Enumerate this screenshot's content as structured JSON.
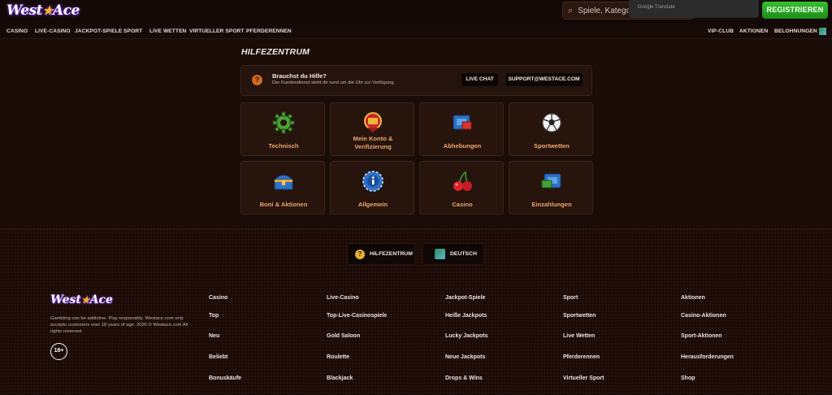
{
  "header": {
    "logo_text_a": "West",
    "logo_text_b": "Ace",
    "search_placeholder": "Spiele, Kategorie",
    "google_translate": "Google Translate",
    "register_label": "REGISTRIEREN"
  },
  "nav": {
    "left": [
      "CASINO",
      "LIVE-CASINO",
      "JACKPOT-SPIELE",
      "SPORT",
      "LIVE WETTEN",
      "VIRTUELLER SPORT",
      "PFERDERENNEN"
    ],
    "right": [
      "VIP-CLUB",
      "AKTIONEN",
      "BELOHNUNGEN"
    ]
  },
  "help": {
    "title": "HILFEZENTRUM",
    "banner_question": "Brauchst du Hilfe?",
    "banner_sub": "Der Kundendienst steht dir rund um die Uhr zur Verfügung.",
    "live_chat": "LIVE CHAT",
    "support_email": "SUPPORT@WESTACE.COM",
    "icon_mark": "?",
    "categories": [
      {
        "label_lines": [
          "Technisch"
        ],
        "icon": "gear-icon"
      },
      {
        "label_lines": [
          "Mein Konto &",
          "Verifizierung"
        ],
        "icon": "account-badge-icon"
      },
      {
        "label_lines": [
          "Abhebungen"
        ],
        "icon": "withdrawal-icon"
      },
      {
        "label_lines": [
          "Sportwetten"
        ],
        "icon": "soccer-ball-icon"
      },
      {
        "label_lines": [
          "Boni & Aktionen"
        ],
        "icon": "treasure-chest-icon"
      },
      {
        "label_lines": [
          "Allgemein"
        ],
        "icon": "info-chip-icon"
      },
      {
        "label_lines": [
          "Casino"
        ],
        "icon": "cherries-icon"
      },
      {
        "label_lines": [
          "Einzahlungen"
        ],
        "icon": "deposit-icon"
      }
    ]
  },
  "footer": {
    "help_center": "HILFEZENTRUM",
    "language": "DEUTSCH",
    "disclaimer": "Gambling can be addictive. Play responsibly. Westace.com only accepts customers over 18 years of age. 2026 © Westace.com All rights reserved.",
    "age": "18+",
    "columns": [
      [
        "Casino",
        "Top",
        "Neu",
        "Beliebt",
        "Bonuskäufe"
      ],
      [
        "Live-Casino",
        "Top-Live-Casinospiele",
        "Gold Saloon",
        "Roulette",
        "Blackjack"
      ],
      [
        "Jackpot-Spiele",
        "Heiße Jackpots",
        "Lucky Jackpots",
        "Neue Jackpots",
        "Drops & Wins"
      ],
      [
        "Sport",
        "Sportwetten",
        "Live Wetten",
        "Pferderennen",
        "Virtueller Sport"
      ],
      [
        "Aktionen",
        "Casino-Aktionen",
        "Sport-Aktionen",
        "Herausforderungen",
        "Shop"
      ]
    ]
  },
  "colors": {
    "accent_orange": "#f0a86c",
    "register_green": "#2aa824",
    "background": "#1a0d08"
  }
}
